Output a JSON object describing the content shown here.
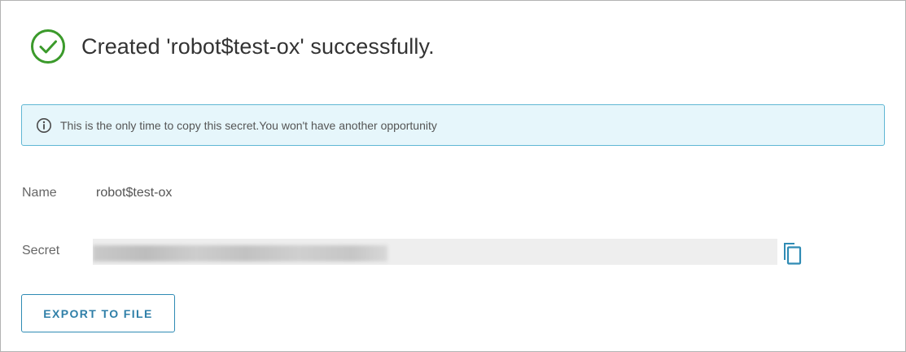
{
  "dialog": {
    "title": "Created 'robot$test-ox' successfully.",
    "status_icon": "check-circle-icon",
    "success_color": "#3b9a2b"
  },
  "alert": {
    "icon": "info-circle-icon",
    "text": "This is the only time to copy this secret.You won't have another opportunity",
    "background_color": "#e6f6fb",
    "border_color": "#60b7d4"
  },
  "details": {
    "name_label": "Name",
    "name_value": "robot$test-ox",
    "secret_label": "Secret",
    "secret_masked": true,
    "copy_icon": "copy-icon"
  },
  "actions": {
    "export_label": "EXPORT TO FILE",
    "accent_color": "#2f8bb4"
  }
}
